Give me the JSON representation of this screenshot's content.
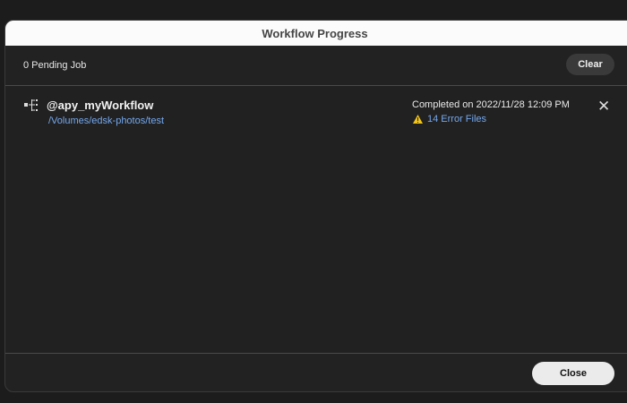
{
  "dialog": {
    "title": "Workflow Progress",
    "close_label": "Close"
  },
  "header": {
    "pending": "0 Pending Job",
    "clear_label": "Clear"
  },
  "jobs": [
    {
      "name": "@apy_myWorkflow",
      "path": "/Volumes/edsk-photos/test",
      "status": "Completed on 2022/11/28 12:09 PM",
      "errors": "14 Error Files",
      "icon": "workflow-icon"
    }
  ],
  "colors": {
    "link": "#74a8ee",
    "warning": "#f0c419"
  }
}
